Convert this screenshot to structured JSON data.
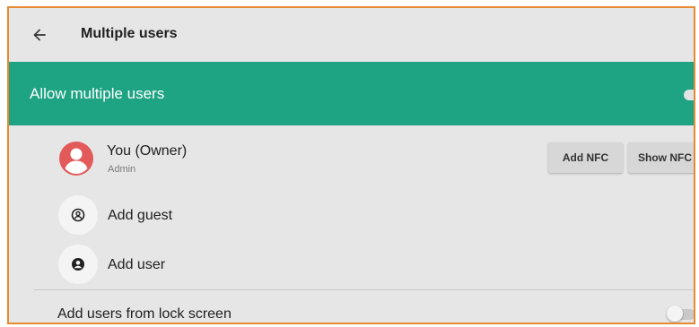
{
  "header": {
    "back_icon": "arrow-left-icon",
    "title": "Multiple users"
  },
  "banner": {
    "label": "Allow multiple users",
    "toggle_on": true,
    "color": "#1ea383"
  },
  "owner": {
    "avatar_icon": "account-circle-icon",
    "avatar_color": "#e35a5a",
    "name": "You (Owner)",
    "role": "Admin",
    "add_nfc_label": "Add NFC",
    "show_nfc_label": "Show NFC"
  },
  "actions": [
    {
      "icon": "guest-account-icon",
      "label": "Add guest"
    },
    {
      "icon": "user-account-icon",
      "label": "Add user"
    }
  ],
  "lock_screen": {
    "label": "Add users from lock screen",
    "toggle_on": false
  }
}
